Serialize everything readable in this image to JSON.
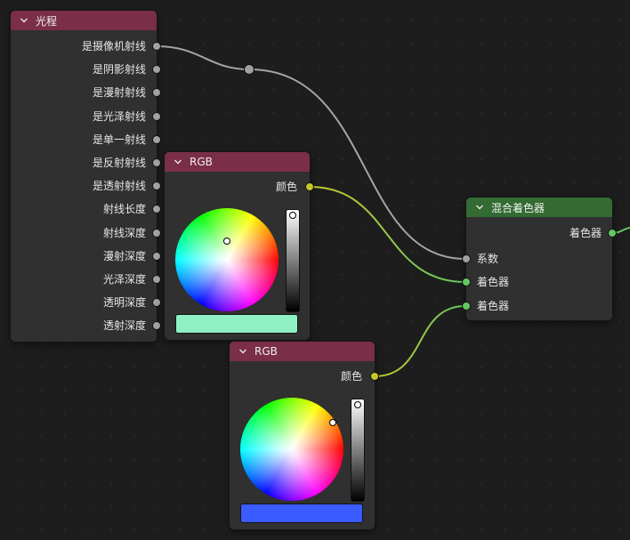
{
  "light_path_node": {
    "title": "光程",
    "header_color": "#7a2e47",
    "outputs": [
      "是摄像机射线",
      "是阴影射线",
      "是漫射射线",
      "是光泽射线",
      "是单一射线",
      "是反射射线",
      "是透射射线",
      "射线长度",
      "射线深度",
      "漫射深度",
      "光泽深度",
      "透明深度",
      "透射深度"
    ]
  },
  "rgb_node_1": {
    "title": "RGB",
    "header_color": "#7a2e47",
    "output": "颜色",
    "color": "#8ff0c3"
  },
  "rgb_node_2": {
    "title": "RGB",
    "header_color": "#7a2e47",
    "output": "颜色",
    "color": "#3a5bff"
  },
  "mix_shader_node": {
    "title": "混合着色器",
    "header_color": "#336b33",
    "output": "着色器",
    "inputs": [
      "系数",
      "着色器",
      "着色器"
    ]
  },
  "socket_colors": {
    "float": "#a1a1a1",
    "color": "#c7c729",
    "shader": "#63c763"
  },
  "icons": {
    "collapse": "chevron-down-icon",
    "reroute": "reroute-dot"
  }
}
